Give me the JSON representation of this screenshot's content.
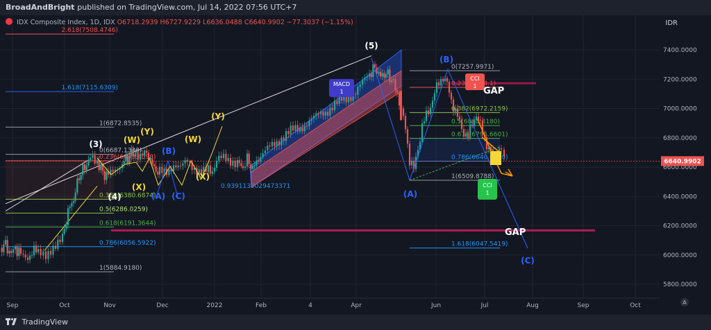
{
  "header": {
    "author": "BroadAndBright",
    "text": "published on TradingView.com, Jul 14, 2022 07:56 UTC+7"
  },
  "legend": {
    "symbol": "IDX Composite Index, 1D, IDX",
    "open": "O6718.2939",
    "high": "H6727.9229",
    "low": "L6636.0488",
    "close": "C6640.9902",
    "change": "−77.3037 (−1.15%)"
  },
  "currency": "IDR",
  "footer": {
    "brand": "TradingView"
  },
  "colors": {
    "background": "#131722",
    "up": "#26a69a",
    "down": "#ef5350",
    "wave_white": "#ffffff",
    "wave_yellow": "#f5d835",
    "wave_blue": "#2962ff",
    "gap": "#e91e63"
  },
  "chart_data": {
    "type": "candlestick",
    "title": "IDX Composite Index, 1D, IDX",
    "x_ticks": [
      "Sep",
      "Oct",
      "Nov",
      "Dec",
      "2022",
      "Feb",
      "4",
      "Apr",
      "Jun",
      "Jul",
      "Aug",
      "Sep",
      "Oct"
    ],
    "y_ticks": [
      "7400.0000",
      "7200.0000",
      "7000.0000",
      "6800.0000",
      "6600.0000",
      "6400.0000",
      "6200.0000",
      "6000.0000",
      "5800.0000"
    ],
    "ylim": [
      5750,
      7500
    ],
    "last_price": "6640.9902",
    "price_path": [
      [
        0,
        6050
      ],
      [
        8,
        6070
      ],
      [
        16,
        6000
      ],
      [
        22,
        6050
      ],
      [
        30,
        6000
      ],
      [
        40,
        5990
      ],
      [
        55,
        6040
      ],
      [
        66,
        6010
      ],
      [
        80,
        6080
      ],
      [
        90,
        6110
      ],
      [
        98,
        6300
      ],
      [
        106,
        6380
      ],
      [
        114,
        6540
      ],
      [
        122,
        6600
      ],
      [
        130,
        6660
      ],
      [
        140,
        6640
      ],
      [
        148,
        6560
      ],
      [
        156,
        6540
      ],
      [
        166,
        6590
      ],
      [
        176,
        6630
      ],
      [
        184,
        6660
      ],
      [
        192,
        6700
      ],
      [
        202,
        6690
      ],
      [
        214,
        6680
      ],
      [
        222,
        6590
      ],
      [
        230,
        6560
      ],
      [
        240,
        6570
      ],
      [
        250,
        6620
      ],
      [
        260,
        6590
      ],
      [
        270,
        6640
      ],
      [
        280,
        6600
      ],
      [
        290,
        6560
      ],
      [
        300,
        6570
      ],
      [
        306,
        6580
      ],
      [
        312,
        6640
      ],
      [
        322,
        6660
      ],
      [
        332,
        6650
      ],
      [
        342,
        6630
      ],
      [
        350,
        6600
      ],
      [
        356,
        6650
      ],
      [
        364,
        6590
      ],
      [
        372,
        6660
      ],
      [
        382,
        6700
      ],
      [
        392,
        6750
      ],
      [
        402,
        6790
      ],
      [
        412,
        6820
      ],
      [
        422,
        6850
      ],
      [
        432,
        6870
      ],
      [
        442,
        6900
      ],
      [
        452,
        6930
      ],
      [
        462,
        6970
      ],
      [
        472,
        6990
      ],
      [
        482,
        7020
      ],
      [
        492,
        7060
      ],
      [
        502,
        7080
      ],
      [
        512,
        7110
      ],
      [
        522,
        7170
      ],
      [
        532,
        7240
      ],
      [
        540,
        7280
      ],
      [
        548,
        7220
      ],
      [
        556,
        7240
      ],
      [
        564,
        7200
      ],
      [
        572,
        7110
      ],
      [
        578,
        6980
      ],
      [
        584,
        6870
      ],
      [
        590,
        6650
      ],
      [
        596,
        6580
      ],
      [
        602,
        6730
      ],
      [
        608,
        6880
      ],
      [
        614,
        6950
      ],
      [
        620,
        7020
      ],
      [
        626,
        7100
      ],
      [
        632,
        7180
      ],
      [
        638,
        7220
      ],
      [
        644,
        7160
      ],
      [
        650,
        7060
      ],
      [
        656,
        6980
      ],
      [
        662,
        6900
      ],
      [
        668,
        6840
      ],
      [
        674,
        6800
      ],
      [
        680,
        6900
      ],
      [
        686,
        6960
      ],
      [
        692,
        6880
      ],
      [
        698,
        6800
      ],
      [
        704,
        6720
      ],
      [
        710,
        6680
      ],
      [
        716,
        6700
      ],
      [
        722,
        6720
      ],
      [
        726,
        6641
      ]
    ],
    "waves": [
      {
        "label": "(3)"
      },
      {
        "label": "(4)"
      },
      {
        "label": "(5)"
      },
      {
        "label": "(W)"
      },
      {
        "label": "(X)"
      },
      {
        "label": "(Y)"
      },
      {
        "label": "(W)"
      },
      {
        "label": "(X)"
      },
      {
        "label": "(Y)"
      },
      {
        "label": "(A)"
      },
      {
        "label": "(B)"
      },
      {
        "label": "(C)"
      },
      {
        "label": "(A)"
      },
      {
        "label": "(B)"
      },
      {
        "label": "(C)"
      }
    ],
    "fib_left": [
      {
        "label": "2.618(7508.4746)",
        "value": 7508.4746
      },
      {
        "label": "1.618(7115.6309)",
        "value": 7115.6309
      },
      {
        "label": "1(6872.8535)",
        "value": 6872.8535
      },
      {
        "label": "0(6687.1338)",
        "value": 6687.1338
      },
      {
        "label": "0.236(6643.4098)",
        "value": 6643.4098
      },
      {
        "label": "0.382(6380.6874)",
        "value": 6380.6874
      },
      {
        "label": "0.5(6286.0259)",
        "value": 6286.0259
      },
      {
        "label": "0.618(6191.3644)",
        "value": 6191.3644
      },
      {
        "label": "0.786(6056.5922)",
        "value": 6056.5922
      },
      {
        "label": "1(5884.9180)",
        "value": 5884.918
      }
    ],
    "fib_right": [
      {
        "label": "0(7257.9971)",
        "value": 7257.9971
      },
      {
        "label": "0.236(7144.1)",
        "value": 7144.1
      },
      {
        "label": "0.382(6972.2159)",
        "value": 6972.2159
      },
      {
        "label": "0.5(6883.3180)",
        "value": 6883.318
      },
      {
        "label": "0.618(6795.6601)",
        "value": 6795.6601
      },
      {
        "label": "0.786(6640.0000)",
        "value": 6640.0
      },
      {
        "label": "1(6509.8788)",
        "value": 6509.8788
      },
      {
        "label": "1.618(6047.5419)",
        "value": 6047.5419
      }
    ],
    "annotations": {
      "macd": "MACD",
      "macd_n": "1",
      "cci_top": "CCI",
      "cci_top_n": "1",
      "cci_bottom": "CCI",
      "cci_bottom_n": "1",
      "gap_top": "GAP",
      "gap_bottom": "GAP",
      "gap_top_value": 7170,
      "gap_bottom_value": 6170,
      "ratio": "0.9391139029473371"
    }
  }
}
